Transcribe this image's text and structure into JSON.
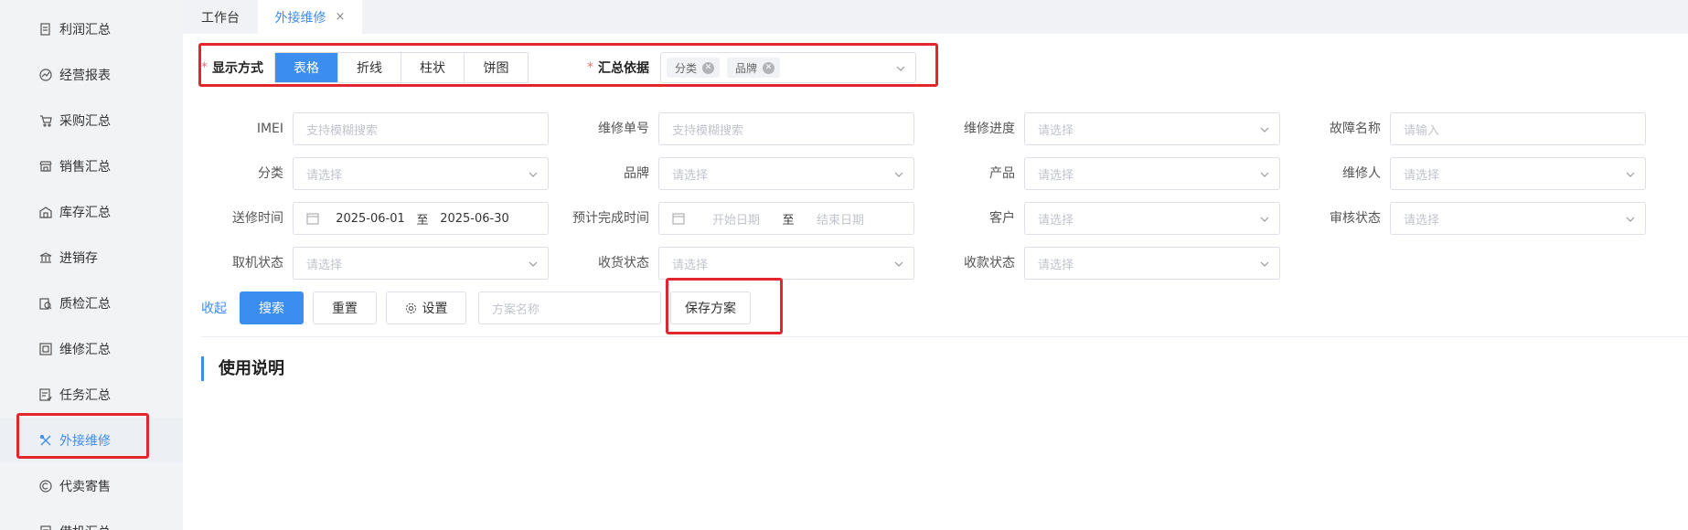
{
  "sidebar": {
    "items": [
      {
        "label": "利润汇总",
        "icon": "receipt-icon"
      },
      {
        "label": "经营报表",
        "icon": "trend-icon"
      },
      {
        "label": "采购汇总",
        "icon": "cart-icon"
      },
      {
        "label": "销售汇总",
        "icon": "shop-icon"
      },
      {
        "label": "库存汇总",
        "icon": "warehouse-icon"
      },
      {
        "label": "进销存",
        "icon": "bank-icon"
      },
      {
        "label": "质检汇总",
        "icon": "inspect-icon"
      },
      {
        "label": "维修汇总",
        "icon": "repair-doc-icon"
      },
      {
        "label": "任务汇总",
        "icon": "task-icon"
      },
      {
        "label": "外接维修",
        "icon": "tools-icon",
        "active": true
      },
      {
        "label": "代卖寄售",
        "icon": "coin-icon"
      },
      {
        "label": "借机汇总",
        "icon": "doc-icon"
      }
    ]
  },
  "tabs": [
    {
      "label": "工作台"
    },
    {
      "label": "外接维修",
      "close": "×",
      "active": true
    }
  ],
  "display_mode": {
    "required_mark": "*",
    "label": "显示方式",
    "options": [
      "表格",
      "折线",
      "柱状",
      "饼图"
    ],
    "selected": "表格"
  },
  "summary_basis": {
    "required_mark": "*",
    "label": "汇总依据",
    "chips": [
      "分类",
      "品牌"
    ]
  },
  "filters": {
    "imei": {
      "label": "IMEI",
      "placeholder": "支持模糊搜索"
    },
    "repair_no": {
      "label": "维修单号",
      "placeholder": "支持模糊搜索"
    },
    "repair_progress": {
      "label": "维修进度",
      "placeholder": "请选择"
    },
    "fault_name": {
      "label": "故障名称",
      "placeholder": "请输入"
    },
    "category": {
      "label": "分类",
      "placeholder": "请选择"
    },
    "brand": {
      "label": "品牌",
      "placeholder": "请选择"
    },
    "product": {
      "label": "产品",
      "placeholder": "请选择"
    },
    "repairer": {
      "label": "维修人",
      "placeholder": "请选择"
    },
    "send_time": {
      "label": "送修时间",
      "start": "2025-06-01",
      "sep": "至",
      "end": "2025-06-30"
    },
    "expected_time": {
      "label": "预计完成时间",
      "start": "开始日期",
      "sep": "至",
      "end": "结束日期"
    },
    "customer": {
      "label": "客户",
      "placeholder": "请选择"
    },
    "audit_status": {
      "label": "审核状态",
      "placeholder": "请选择"
    },
    "pickup_status": {
      "label": "取机状态",
      "placeholder": "请选择"
    },
    "receipt_status": {
      "label": "收货状态",
      "placeholder": "请选择"
    },
    "payment_status": {
      "label": "收款状态",
      "placeholder": "请选择"
    }
  },
  "actions": {
    "collapse": "收起",
    "search": "搜索",
    "reset": "重置",
    "settings": "设置",
    "plan_placeholder": "方案名称",
    "save_plan": "保存方案"
  },
  "section_title": "使用说明",
  "colors": {
    "accent": "#3c8df0",
    "highlight": "#e3262d",
    "required": "#f56c6c"
  }
}
